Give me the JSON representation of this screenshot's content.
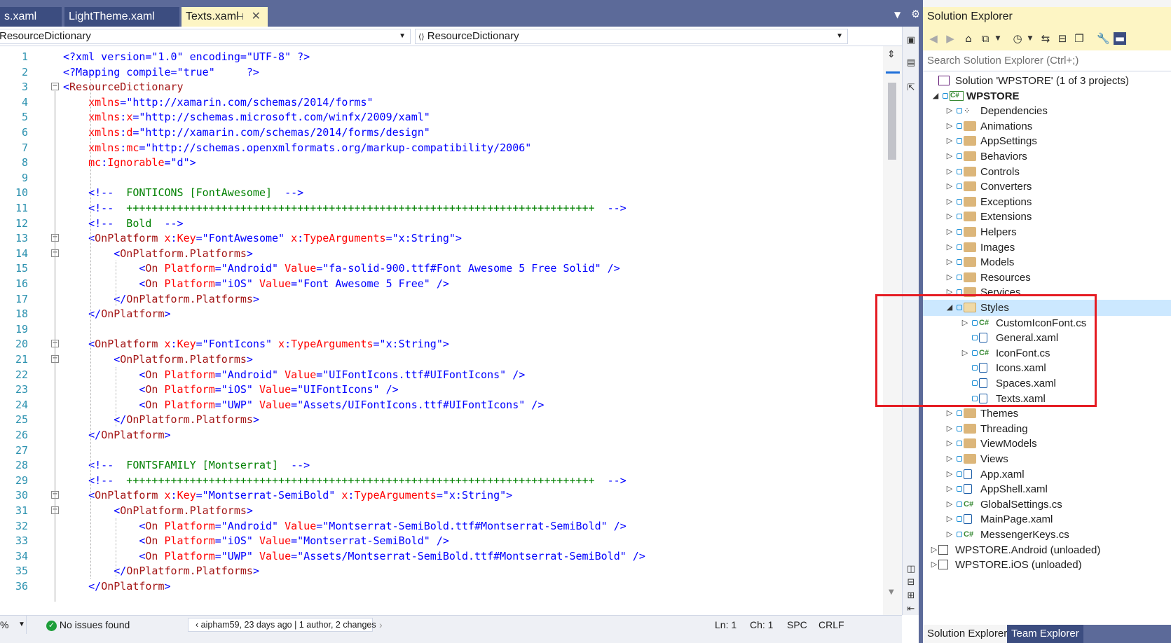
{
  "editor": {
    "tabs": [
      {
        "label": "s.xaml",
        "active": false
      },
      {
        "label": "LightTheme.xaml",
        "active": false
      },
      {
        "label": "Texts.xaml",
        "active": true
      }
    ],
    "nav_left": "ResourceDictionary",
    "nav_right": "ResourceDictionary",
    "lines": [
      [
        [
          "br",
          "<?xml version=\"1.0\" encoding=\"UTF-8\" ?>"
        ]
      ],
      [
        [
          "br",
          "<?Mapping compile=\"true\"     ?>"
        ]
      ],
      [
        [
          "br",
          "<"
        ],
        [
          "tag",
          "ResourceDictionary"
        ]
      ],
      [
        [
          "attr",
          "    xmlns"
        ],
        [
          "br",
          "=\"http://xamarin.com/schemas/2014/forms\""
        ]
      ],
      [
        [
          "attr",
          "    xmlns"
        ],
        [
          "br",
          ":"
        ],
        [
          "attr",
          "x"
        ],
        [
          "br",
          "=\"http://schemas.microsoft.com/winfx/2009/xaml\""
        ]
      ],
      [
        [
          "attr",
          "    xmlns"
        ],
        [
          "br",
          ":"
        ],
        [
          "attr",
          "d"
        ],
        [
          "br",
          "=\"http://xamarin.com/schemas/2014/forms/design\""
        ]
      ],
      [
        [
          "attr",
          "    xmlns"
        ],
        [
          "br",
          ":"
        ],
        [
          "attr",
          "mc"
        ],
        [
          "br",
          "=\"http://schemas.openxmlformats.org/markup-compatibility/2006\""
        ]
      ],
      [
        [
          "attr",
          "    mc"
        ],
        [
          "br",
          ":"
        ],
        [
          "attr",
          "Ignorable"
        ],
        [
          "br",
          "=\"d\">"
        ]
      ],
      [],
      [
        [
          "br",
          "    <!-- "
        ],
        [
          "cm",
          " FONTICONS [FontAwesome] "
        ],
        [
          "br",
          " -->"
        ]
      ],
      [
        [
          "br",
          "    <!-- "
        ],
        [
          "cm",
          " ++++++++++++++++++++++++++++++++++++++++++++++++++++++++++++++++++++++++++ "
        ],
        [
          "br",
          " -->"
        ]
      ],
      [
        [
          "br",
          "    <!-- "
        ],
        [
          "cm",
          " Bold "
        ],
        [
          "br",
          " -->"
        ]
      ],
      [
        [
          "br",
          "    <"
        ],
        [
          "tag",
          "OnPlatform"
        ],
        [
          "attr",
          " x"
        ],
        [
          "br",
          ":"
        ],
        [
          "attr",
          "Key"
        ],
        [
          "br",
          "=\"FontAwesome\""
        ],
        [
          "attr",
          " x"
        ],
        [
          "br",
          ":"
        ],
        [
          "attr",
          "TypeArguments"
        ],
        [
          "br",
          "=\"x:String\">"
        ]
      ],
      [
        [
          "br",
          "        <"
        ],
        [
          "tag",
          "OnPlatform.Platforms"
        ],
        [
          "br",
          ">"
        ]
      ],
      [
        [
          "br",
          "            <"
        ],
        [
          "tag",
          "On"
        ],
        [
          "attr",
          " Platform"
        ],
        [
          "br",
          "=\"Android\""
        ],
        [
          "attr",
          " Value"
        ],
        [
          "br",
          "=\"fa-solid-900.ttf#Font Awesome 5 Free Solid\" />"
        ]
      ],
      [
        [
          "br",
          "            <"
        ],
        [
          "tag",
          "On"
        ],
        [
          "attr",
          " Platform"
        ],
        [
          "br",
          "=\"iOS\""
        ],
        [
          "attr",
          " Value"
        ],
        [
          "br",
          "=\"Font Awesome 5 Free\" />"
        ]
      ],
      [
        [
          "br",
          "        </"
        ],
        [
          "tag",
          "OnPlatform.Platforms"
        ],
        [
          "br",
          ">"
        ]
      ],
      [
        [
          "br",
          "    </"
        ],
        [
          "tag",
          "OnPlatform"
        ],
        [
          "br",
          ">"
        ]
      ],
      [],
      [
        [
          "br",
          "    <"
        ],
        [
          "tag",
          "OnPlatform"
        ],
        [
          "attr",
          " x"
        ],
        [
          "br",
          ":"
        ],
        [
          "attr",
          "Key"
        ],
        [
          "br",
          "=\"FontIcons\""
        ],
        [
          "attr",
          " x"
        ],
        [
          "br",
          ":"
        ],
        [
          "attr",
          "TypeArguments"
        ],
        [
          "br",
          "=\"x:String\">"
        ]
      ],
      [
        [
          "br",
          "        <"
        ],
        [
          "tag",
          "OnPlatform.Platforms"
        ],
        [
          "br",
          ">"
        ]
      ],
      [
        [
          "br",
          "            <"
        ],
        [
          "tag",
          "On"
        ],
        [
          "attr",
          " Platform"
        ],
        [
          "br",
          "=\"Android\""
        ],
        [
          "attr",
          " Value"
        ],
        [
          "br",
          "=\"UIFontIcons.ttf#UIFontIcons\" />"
        ]
      ],
      [
        [
          "br",
          "            <"
        ],
        [
          "tag",
          "On"
        ],
        [
          "attr",
          " Platform"
        ],
        [
          "br",
          "=\"iOS\""
        ],
        [
          "attr",
          " Value"
        ],
        [
          "br",
          "=\"UIFontIcons\" />"
        ]
      ],
      [
        [
          "br",
          "            <"
        ],
        [
          "tag",
          "On"
        ],
        [
          "attr",
          " Platform"
        ],
        [
          "br",
          "=\"UWP\""
        ],
        [
          "attr",
          " Value"
        ],
        [
          "br",
          "=\"Assets/UIFontIcons.ttf#UIFontIcons\" />"
        ]
      ],
      [
        [
          "br",
          "        </"
        ],
        [
          "tag",
          "OnPlatform.Platforms"
        ],
        [
          "br",
          ">"
        ]
      ],
      [
        [
          "br",
          "    </"
        ],
        [
          "tag",
          "OnPlatform"
        ],
        [
          "br",
          ">"
        ]
      ],
      [],
      [
        [
          "br",
          "    <!-- "
        ],
        [
          "cm",
          " FONTSFAMILY [Montserrat] "
        ],
        [
          "br",
          " -->"
        ]
      ],
      [
        [
          "br",
          "    <!-- "
        ],
        [
          "cm",
          " ++++++++++++++++++++++++++++++++++++++++++++++++++++++++++++++++++++++++++ "
        ],
        [
          "br",
          " -->"
        ]
      ],
      [
        [
          "br",
          "    <"
        ],
        [
          "tag",
          "OnPlatform"
        ],
        [
          "attr",
          " x"
        ],
        [
          "br",
          ":"
        ],
        [
          "attr",
          "Key"
        ],
        [
          "br",
          "=\"Montserrat-SemiBold\""
        ],
        [
          "attr",
          " x"
        ],
        [
          "br",
          ":"
        ],
        [
          "attr",
          "TypeArguments"
        ],
        [
          "br",
          "=\"x:String\">"
        ]
      ],
      [
        [
          "br",
          "        <"
        ],
        [
          "tag",
          "OnPlatform.Platforms"
        ],
        [
          "br",
          ">"
        ]
      ],
      [
        [
          "br",
          "            <"
        ],
        [
          "tag",
          "On"
        ],
        [
          "attr",
          " Platform"
        ],
        [
          "br",
          "=\"Android\""
        ],
        [
          "attr",
          " Value"
        ],
        [
          "br",
          "=\"Montserrat-SemiBold.ttf#Montserrat-SemiBold\" />"
        ]
      ],
      [
        [
          "br",
          "            <"
        ],
        [
          "tag",
          "On"
        ],
        [
          "attr",
          " Platform"
        ],
        [
          "br",
          "=\"iOS\""
        ],
        [
          "attr",
          " Value"
        ],
        [
          "br",
          "=\"Montserrat-SemiBold\" />"
        ]
      ],
      [
        [
          "br",
          "            <"
        ],
        [
          "tag",
          "On"
        ],
        [
          "attr",
          " Platform"
        ],
        [
          "br",
          "=\"UWP\""
        ],
        [
          "attr",
          " Value"
        ],
        [
          "br",
          "=\"Assets/Montserrat-SemiBold.ttf#Montserrat-SemiBold\" />"
        ]
      ],
      [
        [
          "br",
          "        </"
        ],
        [
          "tag",
          "OnPlatform.Platforms"
        ],
        [
          "br",
          ">"
        ]
      ],
      [
        [
          "br",
          "    </"
        ],
        [
          "tag",
          "OnPlatform"
        ],
        [
          "br",
          ">"
        ]
      ]
    ]
  },
  "status": {
    "zoom": "%",
    "issues": "No issues found",
    "git": "aipham59, 23 days ago | 1 author, 2 changes",
    "ln": "Ln: 1",
    "ch": "Ch: 1",
    "spc": "SPC",
    "crlf": "CRLF"
  },
  "solution_explorer": {
    "title": "Solution Explorer",
    "search_placeholder": "Search Solution Explorer (Ctrl+;)",
    "tree": [
      {
        "label": "Solution 'WPSTORE' (1 of 3 projects)",
        "icon": "solution-icon"
      },
      {
        "label": "WPSTORE",
        "icon": "csharp-project-icon",
        "bold": true
      },
      {
        "label": "Dependencies",
        "icon": "dependencies-icon"
      },
      {
        "label": "Animations",
        "icon": "folder-icon"
      },
      {
        "label": "AppSettings",
        "icon": "folder-icon"
      },
      {
        "label": "Behaviors",
        "icon": "folder-icon"
      },
      {
        "label": "Controls",
        "icon": "folder-icon"
      },
      {
        "label": "Converters",
        "icon": "folder-icon"
      },
      {
        "label": "Exceptions",
        "icon": "folder-icon"
      },
      {
        "label": "Extensions",
        "icon": "folder-icon"
      },
      {
        "label": "Helpers",
        "icon": "folder-icon"
      },
      {
        "label": "Images",
        "icon": "folder-icon"
      },
      {
        "label": "Models",
        "icon": "folder-icon"
      },
      {
        "label": "Resources",
        "icon": "folder-icon"
      },
      {
        "label": "Services",
        "icon": "folder-icon"
      },
      {
        "label": "Styles",
        "icon": "folder-open-icon",
        "selected": true
      },
      {
        "label": "CustomIconFont.cs",
        "icon": "csharp-file-icon"
      },
      {
        "label": "General.xaml",
        "icon": "xaml-file-icon"
      },
      {
        "label": "IconFont.cs",
        "icon": "csharp-file-icon"
      },
      {
        "label": "Icons.xaml",
        "icon": "xaml-file-icon"
      },
      {
        "label": "Spaces.xaml",
        "icon": "xaml-file-icon"
      },
      {
        "label": "Texts.xaml",
        "icon": "xaml-file-icon"
      },
      {
        "label": "Themes",
        "icon": "folder-icon"
      },
      {
        "label": "Threading",
        "icon": "folder-icon"
      },
      {
        "label": "ViewModels",
        "icon": "folder-icon"
      },
      {
        "label": "Views",
        "icon": "folder-icon"
      },
      {
        "label": "App.xaml",
        "icon": "xaml-file-icon"
      },
      {
        "label": "AppShell.xaml",
        "icon": "xaml-file-icon"
      },
      {
        "label": "GlobalSettings.cs",
        "icon": "csharp-file-icon"
      },
      {
        "label": "MainPage.xaml",
        "icon": "xaml-file-icon"
      },
      {
        "label": "MessengerKeys.cs",
        "icon": "csharp-file-icon"
      },
      {
        "label": "WPSTORE.Android (unloaded)",
        "icon": "unloaded-project-icon"
      },
      {
        "label": "WPSTORE.iOS (unloaded)",
        "icon": "unloaded-project-icon"
      }
    ],
    "bottom_tabs": [
      "Solution Explorer",
      "Team Explorer"
    ]
  },
  "colors": {
    "accent": "#5c6a99",
    "tab_active": "#fdf5c4",
    "highlight_box": "#e51c23"
  }
}
